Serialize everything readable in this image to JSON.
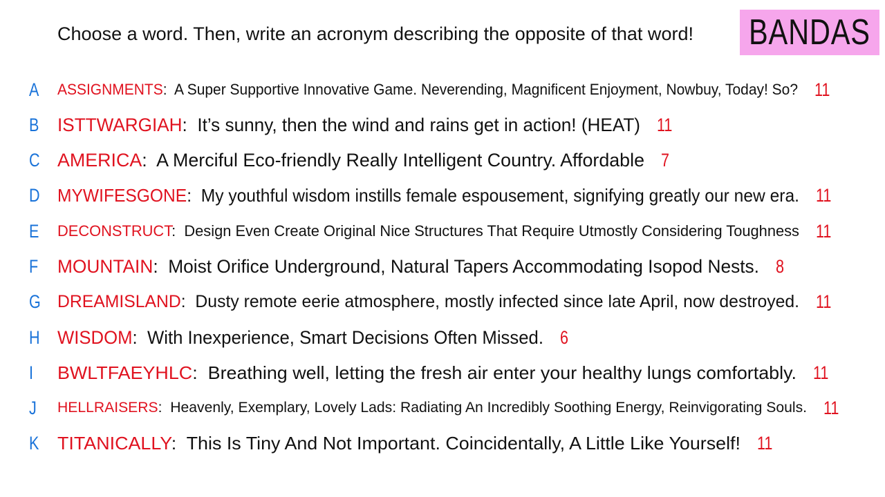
{
  "prompt": "Choose a word. Then, write an acronym describing the opposite of that word!",
  "brand": "BANDAS",
  "colors": {
    "letter": "#1a73d9",
    "word": "#e0121f",
    "number": "#e0121f",
    "brand_bg": "#f6a6ec"
  },
  "entries": [
    {
      "letter": "A",
      "word": "ASSIGNMENTS",
      "acronym": "A Super Supportive Innovative Game. Neverending, Magnificent Enjoyment, Nowbuy, Today! So?",
      "count": "11"
    },
    {
      "letter": "B",
      "word": "ISTTWARGIAH",
      "acronym": "It’s sunny, then the wind and rains get in action! (HEAT)",
      "count": "11"
    },
    {
      "letter": "C",
      "word": "AMERICA",
      "acronym": "A Merciful Eco-friendly Really Intelligent Country. Affordable",
      "count": "7"
    },
    {
      "letter": "D",
      "word": "MYWIFESGONE",
      "acronym": "My youthful wisdom instills female espousement, signifying greatly our new era.",
      "count": "11"
    },
    {
      "letter": "E",
      "word": "DECONSTRUCT",
      "acronym": "Design Even Create Original Nice Structures That Require Utmostly Considering Toughness",
      "count": "11"
    },
    {
      "letter": "F",
      "word": "MOUNTAIN",
      "acronym": "Moist Orifice Underground, Natural Tapers Accommodating Isopod Nests.",
      "count": "8"
    },
    {
      "letter": "G",
      "word": "DREAMISLAND",
      "acronym": "Dusty remote eerie atmosphere, mostly infected since late April, now destroyed.",
      "count": "11"
    },
    {
      "letter": "H",
      "word": "WISDOM",
      "acronym": "With Inexperience, Smart Decisions Often Missed.",
      "count": "6"
    },
    {
      "letter": "I",
      "word": "BWLTFAEYHLC",
      "acronym": "Breathing well, letting the fresh air enter your healthy lungs comfortably.",
      "count": "11"
    },
    {
      "letter": "J",
      "word": "HELLRAISERS",
      "acronym": "Heavenly, Exemplary, Lovely Lads: Radiating An Incredibly Soothing Energy, Reinvigorating Souls.",
      "count": "11"
    },
    {
      "letter": "K",
      "word": "TITANICALLY",
      "acronym": "This Is Tiny And Not Important. Coincidentally, A Little Like Yourself!",
      "count": "11"
    }
  ]
}
